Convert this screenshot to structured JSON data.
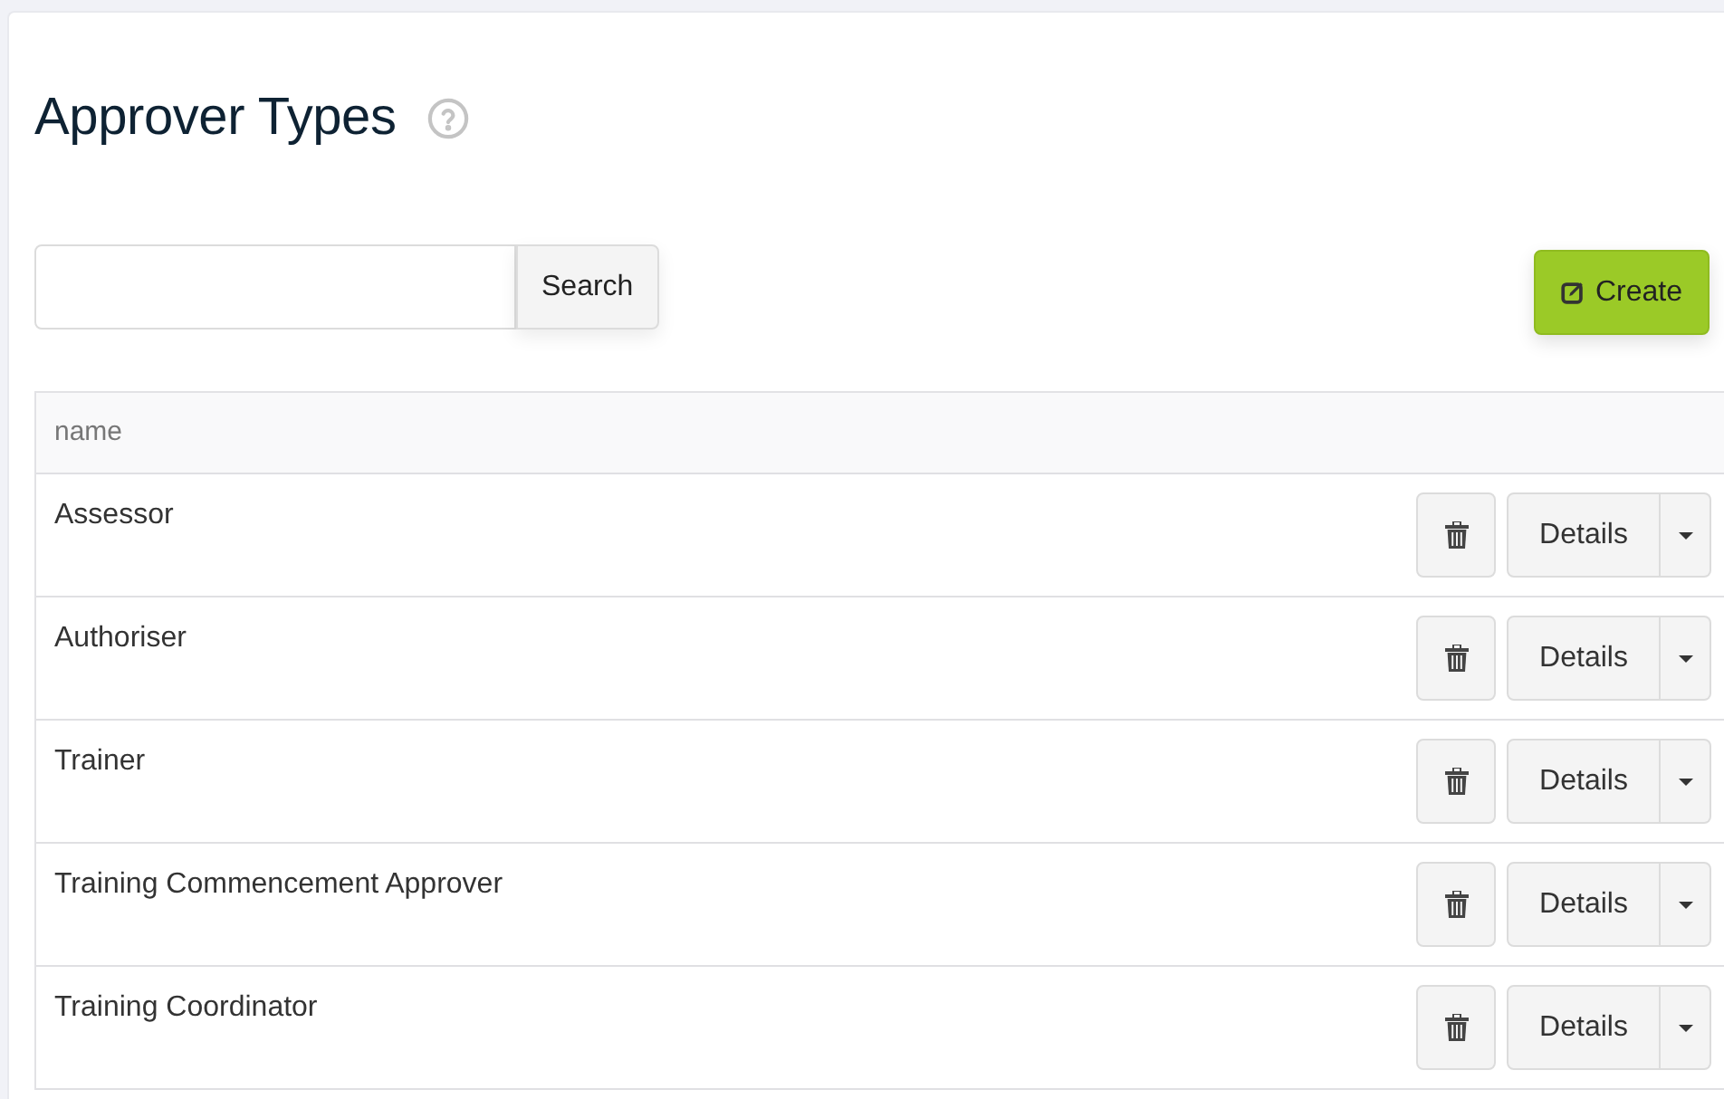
{
  "page": {
    "title": "Approver Types"
  },
  "search": {
    "button": "Search"
  },
  "create_button": "Create",
  "table": {
    "columns": [
      "name"
    ],
    "rows": [
      {
        "name": "Assessor",
        "details_button": "Details"
      },
      {
        "name": "Authoriser",
        "details_button": "Details"
      },
      {
        "name": "Trainer",
        "details_button": "Details"
      },
      {
        "name": "Training Commencement Approver",
        "details_button": "Details"
      },
      {
        "name": "Training Coordinator",
        "details_button": "Details"
      }
    ]
  }
}
